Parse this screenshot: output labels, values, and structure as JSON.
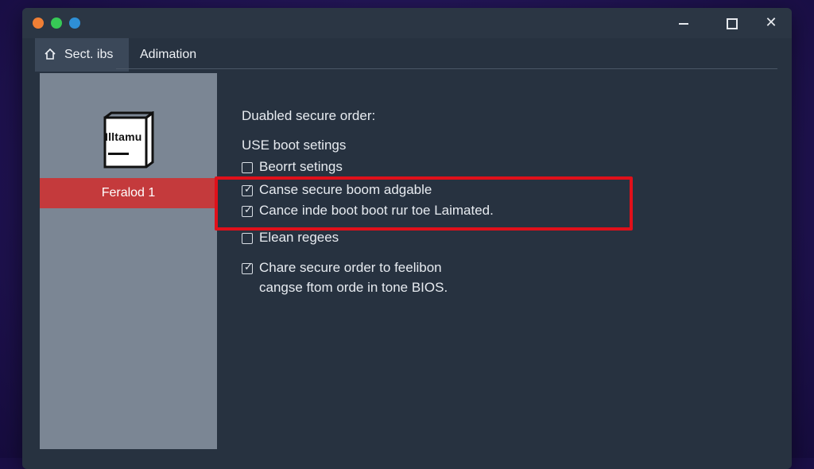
{
  "window": {
    "controls": {
      "traffic_lights": [
        {
          "name": "close-dot",
          "color": "#f07f35"
        },
        {
          "name": "minimize-dot",
          "color": "#37c956"
        },
        {
          "name": "zoom-dot",
          "color": "#2e8fd6"
        }
      ],
      "minimize_icon": "minimize-icon",
      "maximize_icon": "maximize-icon",
      "close_icon": "close-icon",
      "close_glyph": "✕"
    }
  },
  "tabs": [
    {
      "label": "Sect. ibs",
      "icon": "home-icon",
      "active": true
    },
    {
      "label": "Adimation",
      "active": false
    }
  ],
  "sidebar": {
    "logo_text": "Illtamu",
    "selected_item": "Feralod 1"
  },
  "content": {
    "heading": "Duabled secure order:",
    "section_label": "USE boot setings",
    "options": [
      {
        "label": "Beorrt setings",
        "checked": false
      },
      {
        "label": "Canse secure boom adgable",
        "checked": true
      },
      {
        "label": "Cance inde boot boot rur toe Laimated.",
        "checked": true
      },
      {
        "label": "Elean regees",
        "checked": false
      },
      {
        "label": "Chare secure order to feelibon",
        "checked": true
      },
      {
        "label": "cangse ftom orde in tone BIOS.",
        "checked": null
      }
    ],
    "check_glyph": "✓"
  },
  "colors": {
    "accent_red": "#c43a3c",
    "highlight_red": "#e0101a",
    "window_bg": "#273240",
    "sidebar_bg": "#7b8694"
  }
}
